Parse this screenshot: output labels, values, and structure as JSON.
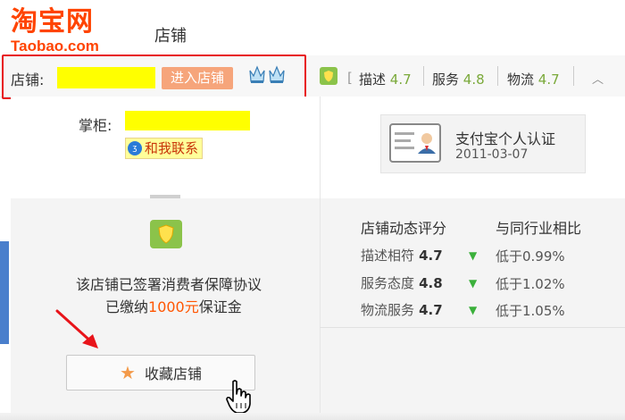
{
  "header": {
    "logo_cn": "淘宝网",
    "logo_en": "Taobao.com",
    "title": "店铺"
  },
  "store_bar": {
    "store_label": "店铺:",
    "enter_button": "进入店铺",
    "ratings": [
      {
        "label": "描述",
        "value": "4.7"
      },
      {
        "label": "服务",
        "value": "4.8"
      },
      {
        "label": "物流",
        "value": "4.7"
      }
    ],
    "bracket": "["
  },
  "seller": {
    "shopkeeper_label": "掌柜:",
    "contact_label": "和我联系"
  },
  "certification": {
    "title": "支付宝个人认证",
    "date": "2011-03-07"
  },
  "guarantee": {
    "line1": "该店铺已签署消费者保障协议",
    "line2_prefix": "已缴纳",
    "amount": "1000元",
    "line2_suffix": "保证金"
  },
  "dsr": {
    "title": "店铺动态评分",
    "compare_title": "与同行业相比",
    "rows": [
      {
        "label": "描述相符",
        "score": "4.7",
        "compare": "低于0.99%"
      },
      {
        "label": "服务态度",
        "score": "4.8",
        "compare": "低于1.02%"
      },
      {
        "label": "物流服务",
        "score": "4.7",
        "compare": "低于1.05%"
      }
    ]
  },
  "actions": {
    "favorite_label": "收藏店铺"
  },
  "colors": {
    "brand": "#ff4400",
    "highlight": "#e8141a",
    "enter_button": "#f6a57b",
    "rating_value": "#7aa93a",
    "down_arrow": "#3bb03b"
  },
  "icons": [
    "shield-icon",
    "crown-icon",
    "id-card-icon",
    "star-icon",
    "hand-cursor-icon",
    "chevron-up-icon"
  ]
}
